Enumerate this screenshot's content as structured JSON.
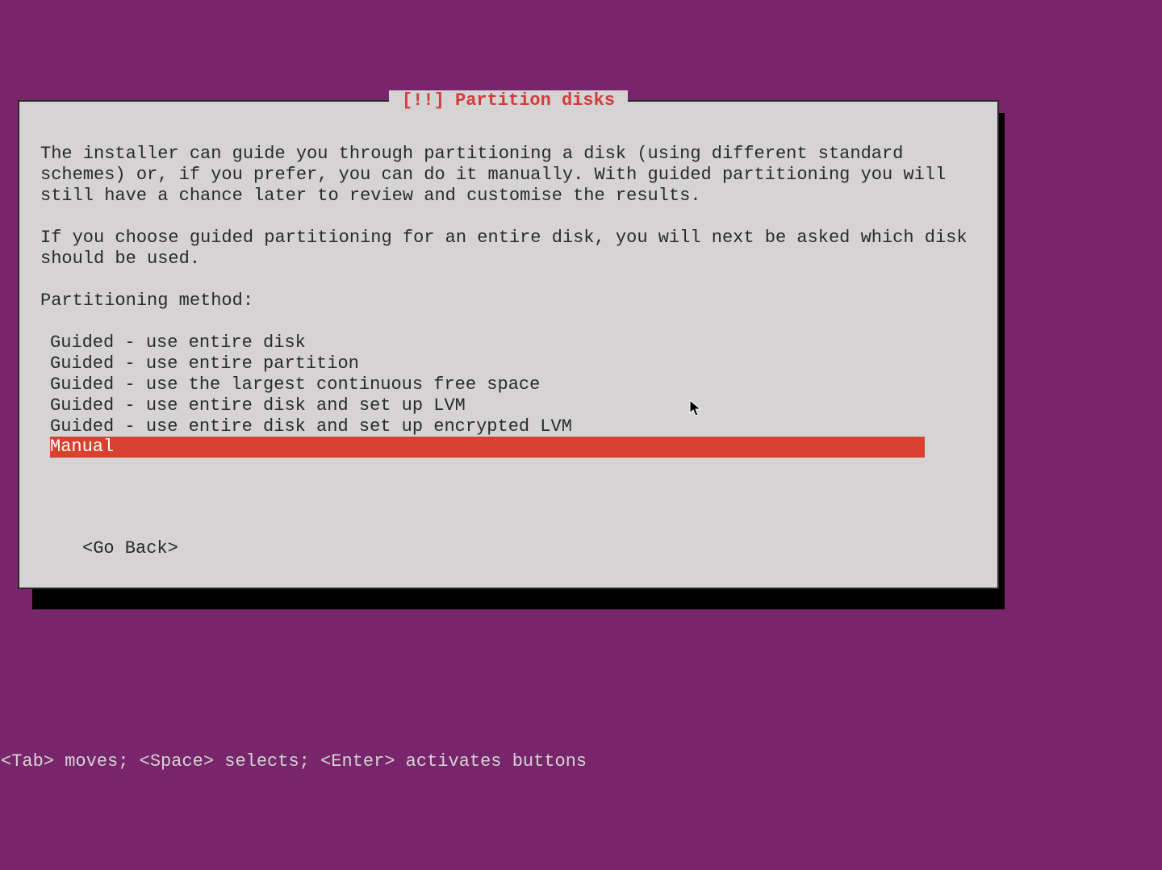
{
  "dialog": {
    "title": "[!!] Partition disks",
    "paragraph1": "The installer can guide you through partitioning a disk (using different standard schemes) or, if you prefer, you can do it manually. With guided partitioning you will still have a chance later to review and customise the results.",
    "paragraph2": "If you choose guided partitioning for an entire disk, you will next be asked which disk should be used.",
    "prompt": "Partitioning method:",
    "menu": [
      {
        "label": "Guided - use entire disk",
        "selected": false
      },
      {
        "label": "Guided - use entire partition",
        "selected": false
      },
      {
        "label": "Guided - use the largest continuous free space",
        "selected": false
      },
      {
        "label": "Guided - use entire disk and set up LVM",
        "selected": false
      },
      {
        "label": "Guided - use entire disk and set up encrypted LVM",
        "selected": false
      },
      {
        "label": "Manual",
        "selected": true
      }
    ],
    "go_back": "<Go Back>"
  },
  "footer": {
    "hint": "<Tab> moves; <Space> selects; <Enter> activates buttons"
  },
  "colors": {
    "background": "#79256c",
    "dialog_bg": "#d6d3d4",
    "title_fg": "#d23c3c",
    "selected_bg": "#d8412f",
    "selected_fg": "#ffffff",
    "text": "#2a2a2a"
  }
}
